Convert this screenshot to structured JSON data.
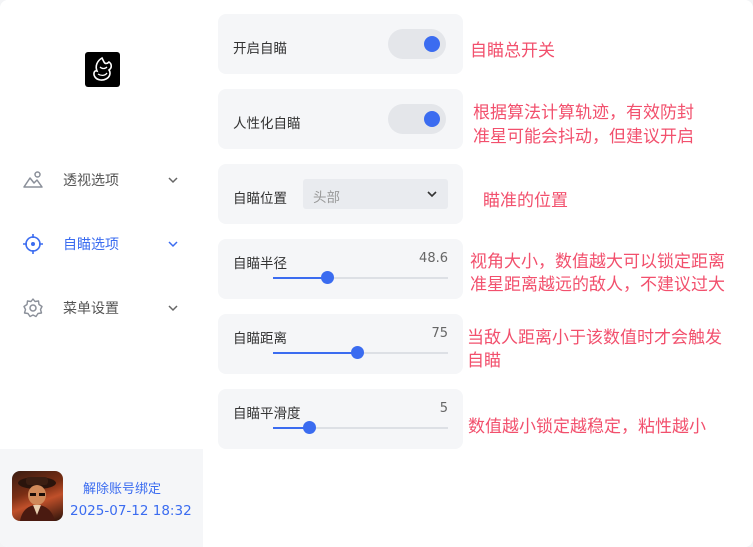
{
  "sidebar": {
    "items": [
      {
        "label": "透视选项",
        "icon": "landscape-icon",
        "active": false
      },
      {
        "label": "自瞄选项",
        "icon": "crosshair-icon",
        "active": true
      },
      {
        "label": "菜单设置",
        "icon": "gear-icon",
        "active": false
      }
    ],
    "account": {
      "unbind_label": "解除账号绑定",
      "timestamp": "2025-07-12 18:32"
    }
  },
  "settings": {
    "aimbot_toggle": {
      "label": "开启自瞄",
      "on": true,
      "note": "自瞄总开关"
    },
    "humanized_toggle": {
      "label": "人性化自瞄",
      "on": true,
      "note_line1": "根据算法计算轨迹，有效防封",
      "note_line2": "准星可能会抖动，但建议开启"
    },
    "aim_position": {
      "label": "自瞄位置",
      "value": "头部",
      "note": "瞄准的位置"
    },
    "aim_radius": {
      "label": "自瞄半径",
      "value": "48.6",
      "fraction": 0.31,
      "note_line1": "视角大小，数值越大可以锁定距离",
      "note_line2": "准星距离越远的敌人，不建议过大"
    },
    "aim_distance": {
      "label": "自瞄距离",
      "value": "75",
      "fraction": 0.48,
      "note_line1": "当敌人距离小于该数值时才会触发",
      "note_line2": "自瞄"
    },
    "aim_smoothing": {
      "label": "自瞄平滑度",
      "value": "5",
      "fraction": 0.21,
      "note": "数值越小锁定越稳定，粘性越小"
    }
  },
  "colors": {
    "accent": "#3b6cf0",
    "annotation": "#f2506d"
  }
}
